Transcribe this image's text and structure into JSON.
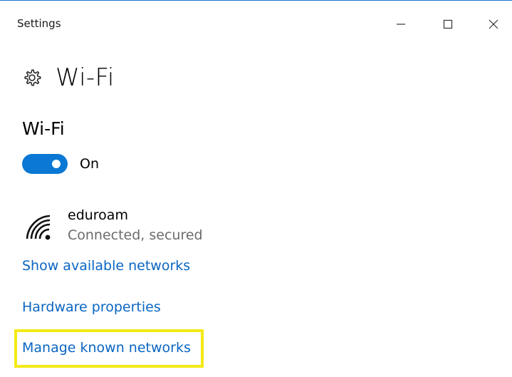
{
  "window": {
    "title": "Settings",
    "controls": {
      "minimize_icon": "minimize-icon",
      "maximize_icon": "maximize-icon",
      "close_icon": "close-icon"
    }
  },
  "page": {
    "icon": "gear-icon",
    "title": "Wi-Fi"
  },
  "wifi_section": {
    "title": "Wi-Fi",
    "toggle_state": "On",
    "toggle_color": "#0a78d4"
  },
  "network": {
    "icon": "wifi-signal-icon",
    "name": "eduroam",
    "status": "Connected, secured"
  },
  "links": {
    "show_available": "Show available networks",
    "hardware_properties": "Hardware properties",
    "manage_known": "Manage known networks"
  },
  "annotation": {
    "highlight_color": "#f4ea14"
  }
}
